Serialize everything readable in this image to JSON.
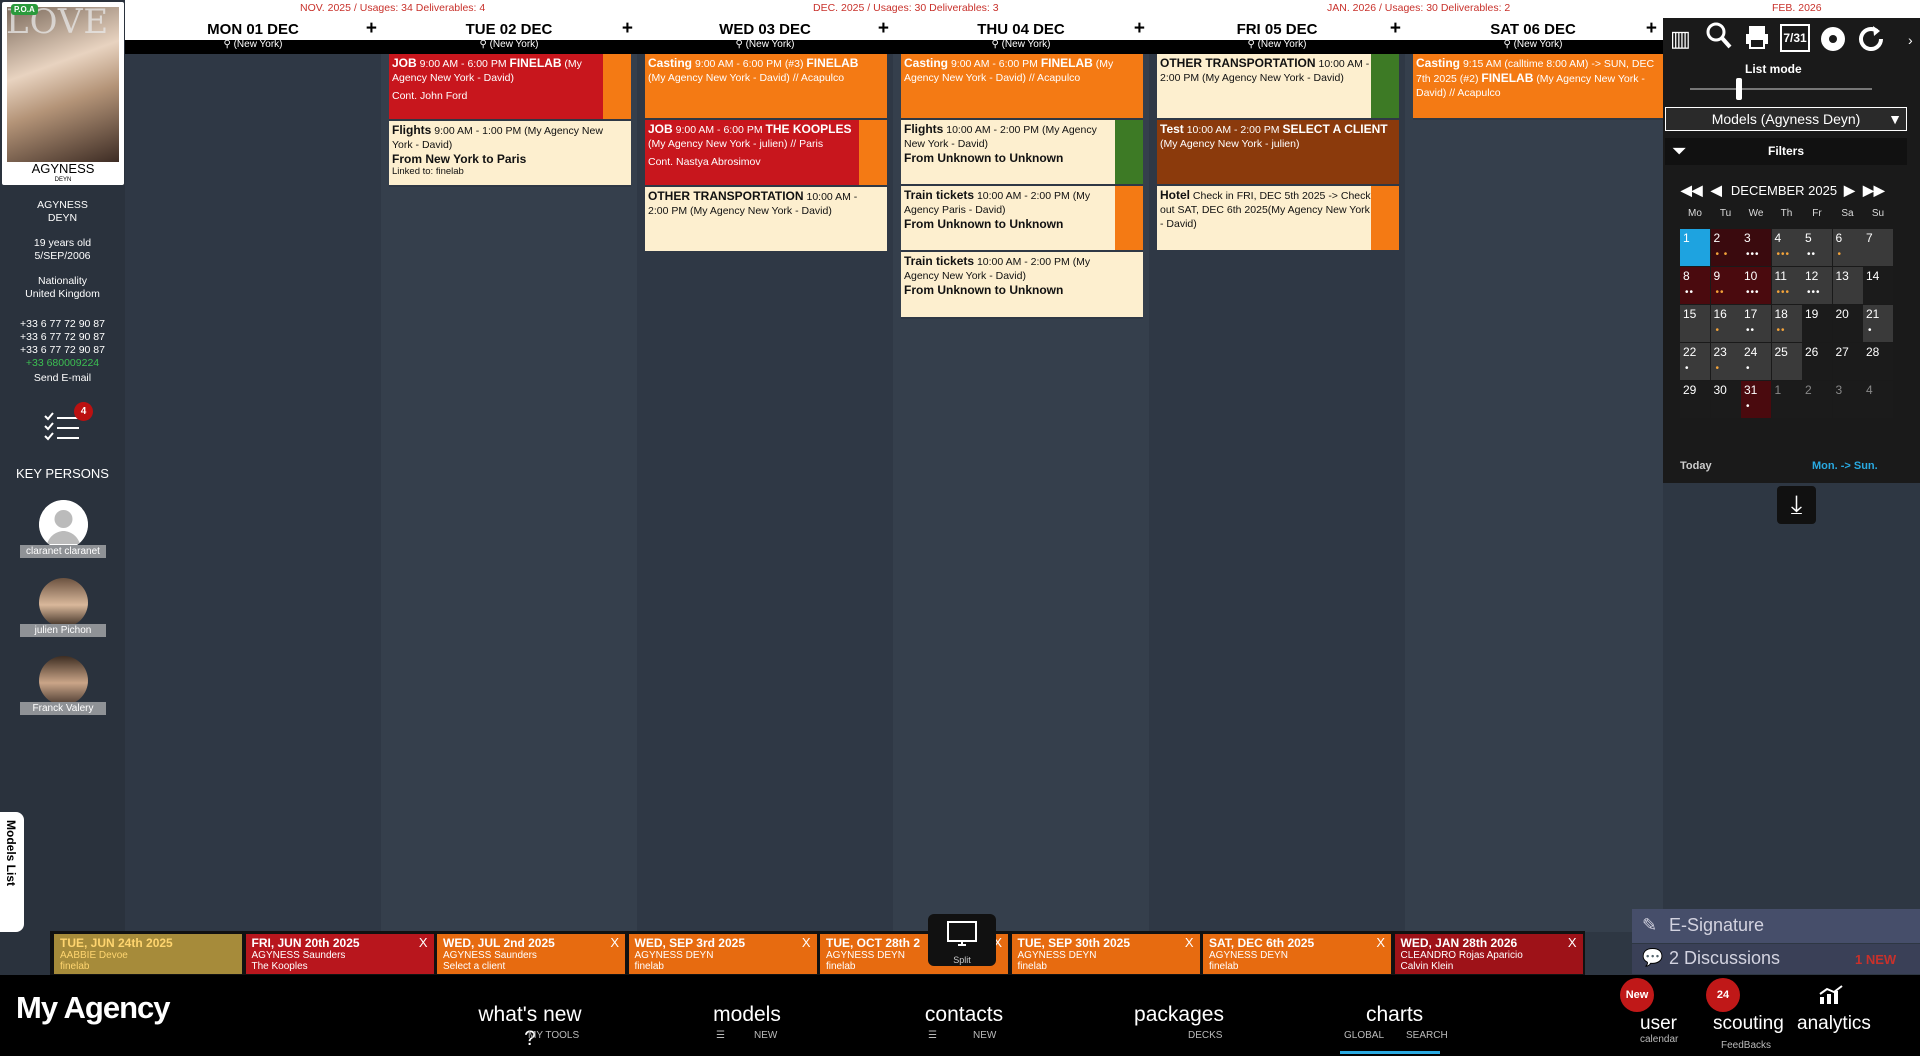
{
  "usage": {
    "nov": "NOV. 2025 / Usages: 34  Deliverables: 4",
    "dec": "DEC. 2025 / Usages: 30  Deliverables: 3",
    "jan": "JAN. 2026 / Usages: 30  Deliverables: 2",
    "feb": "FEB. 2026"
  },
  "days": [
    {
      "name": "MON 01 DEC",
      "loc": "(New York)"
    },
    {
      "name": "TUE 02 DEC",
      "loc": "(New York)"
    },
    {
      "name": "WED 03 DEC",
      "loc": "(New York)"
    },
    {
      "name": "THU 04 DEC",
      "loc": "(New York)"
    },
    {
      "name": "FRI 05 DEC",
      "loc": "(New York)"
    },
    {
      "name": "SAT 06 DEC",
      "loc": "(New York)"
    }
  ],
  "model": {
    "cover_title": "LOVE",
    "poa": "P.O.A",
    "cover_name": "AGYNESS",
    "cover_sub": "DEYN",
    "name1": "AGYNESS",
    "name2": "DEYN",
    "age": "19 years old",
    "dob": "5/SEP/2006",
    "nationality_label": "Nationality",
    "nationality": "United Kingdom",
    "phone1": "+33 6 77 72 90 87",
    "phone2": "+33 6 77 72 90 87",
    "phone3": "+33 6 77 72 90 87",
    "phone4": "+33 680009224",
    "send_email": "Send E-mail",
    "todo_count": "4"
  },
  "key_persons": {
    "title": "KEY PERSONS",
    "items": [
      {
        "name": "claranet claranet"
      },
      {
        "name": "julien Pichon"
      },
      {
        "name": "Franck Valery"
      }
    ]
  },
  "models_list_tab": "Models List",
  "events": {
    "tue1": {
      "type": "JOB",
      "time": "9:00 AM - 6:00 PM",
      "client": "FINELAB",
      "agency": "(My Agency New York - David)",
      "note": "Cont. John  Ford"
    },
    "tue2": {
      "type": "Flights",
      "time": "9:00 AM - 1:00 PM",
      "agency": "(My Agency New York - David)",
      "route": "From New York to Paris",
      "note": "Linked to: finelab"
    },
    "wed1": {
      "type": "Casting",
      "time": "9:00 AM - 6:00 PM (#3)",
      "client": "FINELAB",
      "agency": "(My Agency New York - David) // Acapulco"
    },
    "wed2": {
      "type": "JOB",
      "time": "9:00 AM - 6:00 PM",
      "client": "THE KOOPLES",
      "agency": "(My Agency New York - julien) // Paris",
      "note": "Cont. Nastya Abrosimov"
    },
    "wed3": {
      "type": "OTHER TRANSPORTATION",
      "time": "10:00 AM - 2:00 PM",
      "agency": "(My Agency New York - David)"
    },
    "thu1": {
      "type": "Casting",
      "time": "9:00 AM - 6:00 PM",
      "client": "FINELAB",
      "agency": "(My Agency New York - David) // Acapulco"
    },
    "thu2": {
      "type": "Flights",
      "time": "10:00 AM - 2:00 PM",
      "agency": "(My Agency New York - David)",
      "route": "From Unknown to Unknown"
    },
    "thu3": {
      "type": "Train tickets",
      "time": "10:00 AM - 2:00 PM",
      "agency": "(My Agency Paris - David)",
      "route": "From Unknown to Unknown"
    },
    "thu4": {
      "type": "Train tickets",
      "time": "10:00 AM - 2:00 PM",
      "agency": "(My Agency New York - David)",
      "route": "From Unknown to Unknown"
    },
    "fri1": {
      "type": "OTHER TRANSPORTATION",
      "time": "10:00 AM - 2:00 PM",
      "agency": "(My Agency New York - David)"
    },
    "fri2": {
      "type": "Test",
      "time": "10:00 AM - 2:00 PM",
      "client": "SELECT A CLIENT",
      "agency": "(My Agency New York - julien)"
    },
    "fri3": {
      "type": "Hotel",
      "time": "Check in FRI, DEC 5th 2025 -> Check out SAT, DEC 6th 2025",
      "agency": "(My Agency New York - David)"
    },
    "sat1": {
      "type": "Casting",
      "time": "9:15 AM (calltime 8:00 AM)  ->  SUN, DEC 7th 2025 (#2)",
      "client": "FINELAB",
      "agency": "(My Agency New York - David) // Acapulco"
    }
  },
  "right_panel": {
    "list_mode": "List mode",
    "models_select": "Models (Agyness Deyn)",
    "filters": "Filters",
    "calendar_icon_text": "7/31",
    "month": "DECEMBER 2025",
    "dow": [
      "Mo",
      "Tu",
      "We",
      "Th",
      "Fr",
      "Sa",
      "Su"
    ],
    "weeks": [
      [
        "1",
        "2",
        "3",
        "4",
        "5",
        "6",
        "7"
      ],
      [
        "8",
        "9",
        "10",
        "11",
        "12",
        "13",
        "14"
      ],
      [
        "15",
        "16",
        "17",
        "18",
        "19",
        "20",
        "21"
      ],
      [
        "22",
        "23",
        "24",
        "25",
        "26",
        "27",
        "28"
      ],
      [
        "29",
        "30",
        "31",
        "1",
        "2",
        "3",
        "4"
      ]
    ],
    "today": "Today",
    "range": "Mon. -> Sun."
  },
  "recent": [
    {
      "date": "TUE, JUN 24th 2025",
      "l1": "AABBIE Devoe",
      "l2": "finelab"
    },
    {
      "date": "FRI, JUN 20th 2025",
      "l1": "AGYNESS Saunders",
      "l2": "The Kooples"
    },
    {
      "date": "WED, JUL 2nd 2025",
      "l1": "AGYNESS Saunders",
      "l2": "Select a client"
    },
    {
      "date": "WED, SEP 3rd 2025",
      "l1": "AGYNESS DEYN",
      "l2": "finelab"
    },
    {
      "date": "TUE, OCT 28th 2",
      "l1": "AGYNESS DEYN",
      "l2": "finelab"
    },
    {
      "date": "TUE, SEP 30th 2025",
      "l1": "AGYNESS DEYN",
      "l2": "finelab"
    },
    {
      "date": "SAT, DEC 6th 2025",
      "l1": "AGYNESS DEYN",
      "l2": "finelab"
    },
    {
      "date": "WED, JAN 28th 2026",
      "l1": "CLEANDRO Rojas Aparicio",
      "l2": "Calvin Klein"
    }
  ],
  "split": "Split",
  "esignature": "E-Signature",
  "discussions": "2 Discussions",
  "discussions_new": "1 NEW",
  "nav": {
    "brand": "My Agency",
    "whats_new": "what's new ?",
    "whats_new_sub": "MY TOOLS",
    "models": "models",
    "models_sub": "NEW",
    "contacts": "contacts",
    "contacts_sub": "NEW",
    "packages": "packages",
    "packages_sub": "DECKS",
    "charts": "charts",
    "charts_sub1": "GLOBAL",
    "charts_sub2": "SEARCH",
    "user": "user",
    "user_sub": "calendar",
    "user_badge": "New",
    "scouting": "scouting",
    "scouting_sub": "FeedBacks",
    "scouting_badge": "24",
    "analytics": "analytics"
  },
  "colors": {
    "job": "#c8161d",
    "casting": "#f47a14",
    "travel": "#fdefcf",
    "test": "#8b3a0c",
    "accent": "#29a9e1"
  }
}
